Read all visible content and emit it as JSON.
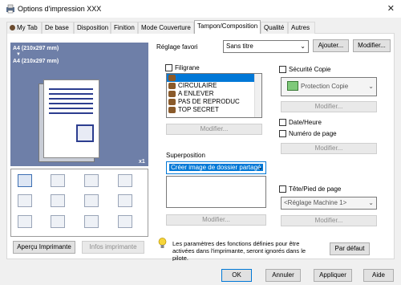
{
  "window": {
    "title": "Options d'impression XXX",
    "close_glyph": "✕"
  },
  "tabs": [
    {
      "label": "My Tab",
      "icon": "user-icon"
    },
    {
      "label": "De base"
    },
    {
      "label": "Disposition"
    },
    {
      "label": "Finition"
    },
    {
      "label": "Mode Couverture"
    },
    {
      "label": "Tampon/Composition",
      "active": true
    },
    {
      "label": "Qualité"
    },
    {
      "label": "Autres"
    }
  ],
  "preview": {
    "line1": "A4 (210x297 mm)",
    "arrow": "▼",
    "line2": "A4 (210x297 mm)",
    "count": "x1"
  },
  "left_buttons": {
    "apercu": "Aperçu Imprimante",
    "infos": "Infos imprimante"
  },
  "favorite": {
    "label": "Réglage favori",
    "value": "Sans titre",
    "ajouter": "Ajouter...",
    "modifier": "Modifier..."
  },
  "filigrane": {
    "label": "Filigrane",
    "items": [
      "",
      "CIRCULAIRE",
      "A ENLEVER",
      "PAS DE REPRODUC",
      "TOP SECRET"
    ],
    "modifier": "Modifier..."
  },
  "superposition": {
    "label": "Superposition",
    "value": "Créer image de dossier partagé",
    "modifier": "Modifier..."
  },
  "securite": {
    "label": "Sécurité Copie",
    "value": "Protection Copie",
    "modifier": "Modifier..."
  },
  "date_heure": {
    "label": "Date/Heure"
  },
  "numero_page": {
    "label": "Numéro de page",
    "modifier": "Modifier..."
  },
  "tete_pied": {
    "label": "Tête/Pied de page",
    "value": "<Réglage Machine 1>",
    "modifier": "Modifier..."
  },
  "info": {
    "text": "Les paramètres des fonctions définies pour être activées dans l'imprimante, seront ignorés dans le pilote."
  },
  "par_defaut": "Par défaut",
  "footer": {
    "ok": "OK",
    "annuler": "Annuler",
    "appliquer": "Appliquer",
    "aide": "Aide"
  }
}
